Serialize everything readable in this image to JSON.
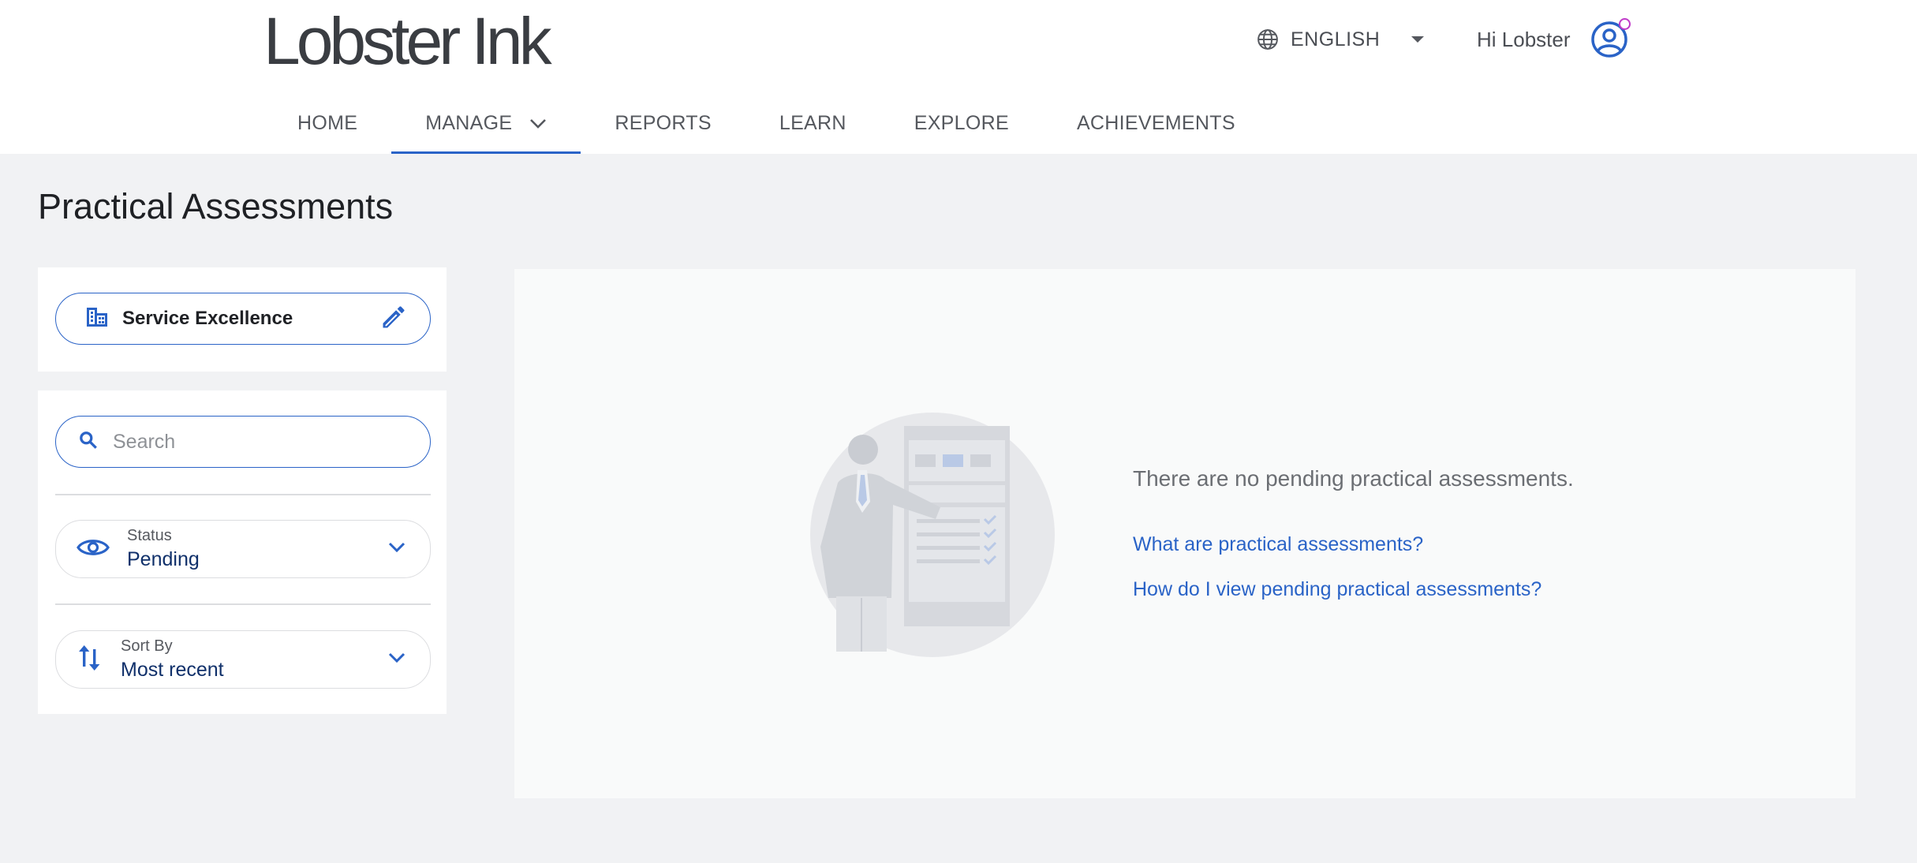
{
  "header": {
    "logo": "Lobster Ink",
    "language": "ENGLISH",
    "greeting": "Hi Lobster"
  },
  "nav": {
    "items": [
      {
        "label": "HOME"
      },
      {
        "label": "MANAGE",
        "active": true
      },
      {
        "label": "REPORTS"
      },
      {
        "label": "LEARN"
      },
      {
        "label": "EXPLORE"
      },
      {
        "label": "ACHIEVEMENTS"
      }
    ]
  },
  "page": {
    "title": "Practical Assessments"
  },
  "filters": {
    "organization": "Service Excellence",
    "search_placeholder": "Search",
    "status": {
      "caption": "Status",
      "value": "Pending"
    },
    "sort": {
      "caption": "Sort By",
      "value": "Most recent"
    }
  },
  "empty_state": {
    "message": "There are no pending practical assessments.",
    "links": [
      "What are practical assessments?",
      "How do I view pending practical assessments?"
    ]
  },
  "colors": {
    "accent": "#2a63c7",
    "badge": "#c03bc9",
    "background": "#f1f2f4"
  },
  "icons": [
    "globe-icon",
    "caret-down-icon",
    "user-circle-icon",
    "chevron-down-icon",
    "building-icon",
    "pencil-icon",
    "search-icon",
    "eye-icon",
    "sort-icon"
  ]
}
